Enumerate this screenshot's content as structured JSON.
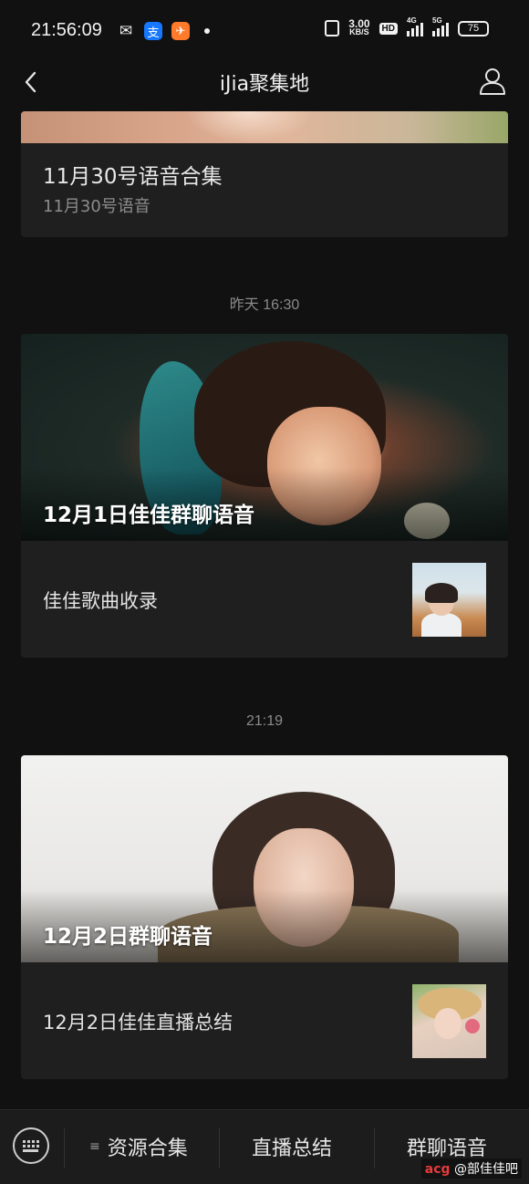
{
  "status_bar": {
    "time": "21:56:09",
    "net_speed": "3.00",
    "net_unit": "KB/S",
    "hd_label": "HD",
    "signal1_label": "4G",
    "signal2_label": "5G",
    "battery": "75"
  },
  "header": {
    "title": "iJia聚集地"
  },
  "messages": [
    {
      "title": "11月30号语音合集",
      "subtitle": "11月30号语音"
    },
    {
      "timestamp": "昨天 16:30",
      "cover_title": "12月1日佳佳群聊语音",
      "sub_title": "佳佳歌曲收录"
    },
    {
      "timestamp": "21:19",
      "cover_title": "12月2日群聊语音",
      "sub_title": "12月2日佳佳直播总结"
    }
  ],
  "bottom_menu": {
    "items": [
      "资源合集",
      "直播总结",
      "群聊语音"
    ]
  },
  "watermark": {
    "prefix": "acg",
    "text": "@部佳佳吧"
  },
  "icons": {
    "back": "chevron-left-icon",
    "profile": "user-icon",
    "keyboard": "keyboard-icon",
    "menu": "menu-lines-icon"
  }
}
